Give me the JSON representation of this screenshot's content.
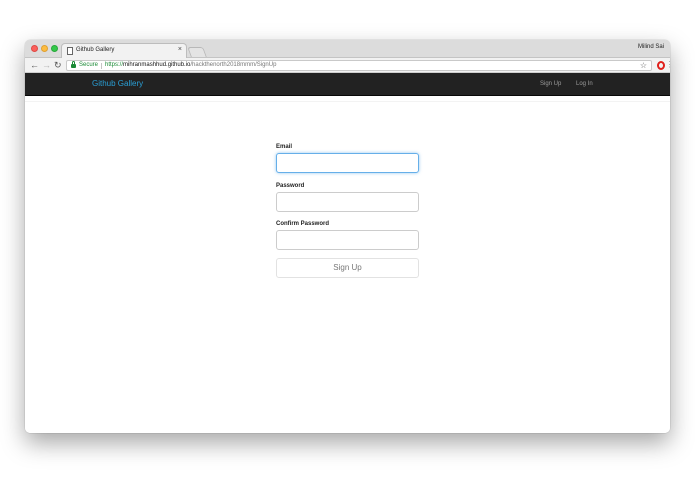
{
  "browser": {
    "tab_title": "Github Gallery",
    "tab_close": "×",
    "profile_name": "Milind Sai",
    "secure_label": "Secure",
    "url_scheme": "https://",
    "url_host": "mihranmashhud.github.io",
    "url_path": "/hackthenorth2018mmm/SignUp",
    "icons": {
      "back": "back-arrow-icon",
      "forward": "forward-arrow-icon",
      "reload": "reload-icon",
      "lock": "lock-icon",
      "star": "star-icon",
      "opera": "opera-icon",
      "menu": "menu-icon"
    }
  },
  "navbar": {
    "brand": "Github Gallery",
    "links": [
      "Sign Up",
      "Log In"
    ]
  },
  "form": {
    "email_label": "Email",
    "email_value": "",
    "password_label": "Password",
    "password_value": "",
    "confirm_label": "Confirm Password",
    "confirm_value": "",
    "submit_label": "Sign Up"
  },
  "colors": {
    "navbar_bg": "#222222",
    "brand": "#2a9fd6",
    "secure": "#1a8a35",
    "focus_border": "#66afe9"
  }
}
